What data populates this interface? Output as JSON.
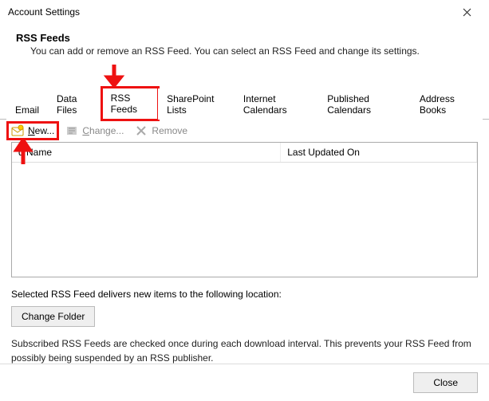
{
  "window": {
    "title": "Account Settings"
  },
  "header": {
    "heading": "RSS Feeds",
    "description": "You can add or remove an RSS Feed. You can select an RSS Feed and change its settings."
  },
  "tabs": {
    "items": [
      {
        "label": "Email"
      },
      {
        "label": "Data Files"
      },
      {
        "label": "RSS Feeds"
      },
      {
        "label": "SharePoint Lists"
      },
      {
        "label": "Internet Calendars"
      },
      {
        "label": "Published Calendars"
      },
      {
        "label": "Address Books"
      }
    ]
  },
  "toolbar": {
    "new_label_prefix": "N",
    "new_label_rest": "ew...",
    "change_label_prefix": "C",
    "change_label_rest": "hange...",
    "remove_label": "Remove"
  },
  "list": {
    "col_name": "d Name",
    "col_updated": "Last Updated On"
  },
  "delivery": {
    "text": "Selected RSS Feed delivers new items to the following location:",
    "change_folder": "Change Folder"
  },
  "note": {
    "text": "Subscribed RSS Feeds are checked once during each download interval. This prevents your RSS Feed from possibly being suspended by an RSS publisher."
  },
  "footer": {
    "close": "Close"
  }
}
